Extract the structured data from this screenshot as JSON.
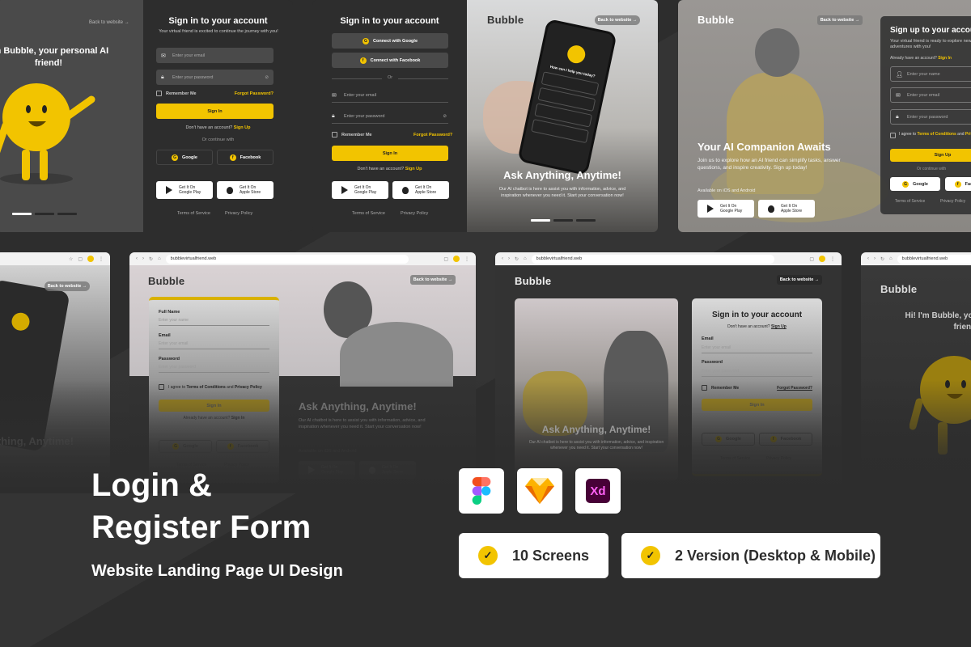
{
  "common": {
    "back_to_website": "Back to website →",
    "logo": "Bubble",
    "email_placeholder": "Enter your email",
    "password_placeholder": "Enter your password",
    "name_placeholder": "Enter your name",
    "remember_me": "Remember Me",
    "forgot_password": "Forgot Password?",
    "sign_in": "Sign In",
    "sign_up": "Sign Up",
    "dont_have_account": "Don't have an account?",
    "already_have_account": "Already have an account?",
    "or_continue_with": "Or continue with",
    "or": "Or",
    "google": "Google",
    "facebook": "Facebook",
    "connect_google": "Connect with Google",
    "connect_facebook": "Connect with Facebook",
    "get_it_on": "Get It On",
    "google_play": "Google Play",
    "apple_store": "Apple Store",
    "terms": "Terms of Service",
    "privacy": "Privacy Policy",
    "full_name": "Full Name",
    "email": "Email",
    "password": "Password",
    "agree_prefix": "I agree to",
    "terms_conditions": "Terms of Conditions",
    "and": "and",
    "privacy_policy": "Privacy Policy",
    "policy": "Policy",
    "url": "bubblevirtualfriend.web",
    "available": "Available on iOS and Android"
  },
  "card_a": {
    "headline": "I'm Bubble, your personal AI friend!",
    "title": "Sign in to your account",
    "subtitle": "Your virtual friend is excited to continue the journey with you!"
  },
  "card_b": {
    "title": "Sign in to your account",
    "hero_title": "Ask Anything, Anytime!",
    "hero_text": "Our AI chatbot is here to assist you with information, advice, and inspiration whenever you need it. Start your conversation now!",
    "phone_question": "How can I help you today?"
  },
  "card_c": {
    "hero_title": "Your AI Companion Awaits",
    "hero_text": "Join us to explore how an AI friend can simplify tasks, answer questions, and inspire creativity. Sign up today!",
    "form_title": "Sign up to your account",
    "form_subtitle": "Your virtual friend is ready to explore new adventures with you!"
  },
  "card_e": {
    "hero_title": "Ask Anything, Anytime!",
    "hero_text": "Our AI chatbot is here to assist you with information, advice, and inspiration whenever you need it. Start your conversation now!"
  },
  "card_f": {
    "title": "Sign in to your account",
    "hero_title": "Ask Anything, Anytime!",
    "hero_text": "Our AI chatbot is here to assist you with information, advice, and inspiration whenever you need it. Start your conversation now!"
  },
  "card_g": {
    "headline": "Hi! I'm Bubble, your personal AI friend!"
  },
  "promo": {
    "title_line1": "Login &",
    "title_line2": "Register Form",
    "subtitle": "Website Landing Page UI Design",
    "tools": [
      "figma-icon",
      "sketch-icon",
      "xd-icon"
    ],
    "xd_label": "Xd",
    "badges": [
      "10 Screens",
      "2 Version (Desktop & Mobile)"
    ]
  },
  "colors": {
    "accent": "#f2c400",
    "background": "#2d2d2d",
    "panel": "#2f2f2f"
  }
}
